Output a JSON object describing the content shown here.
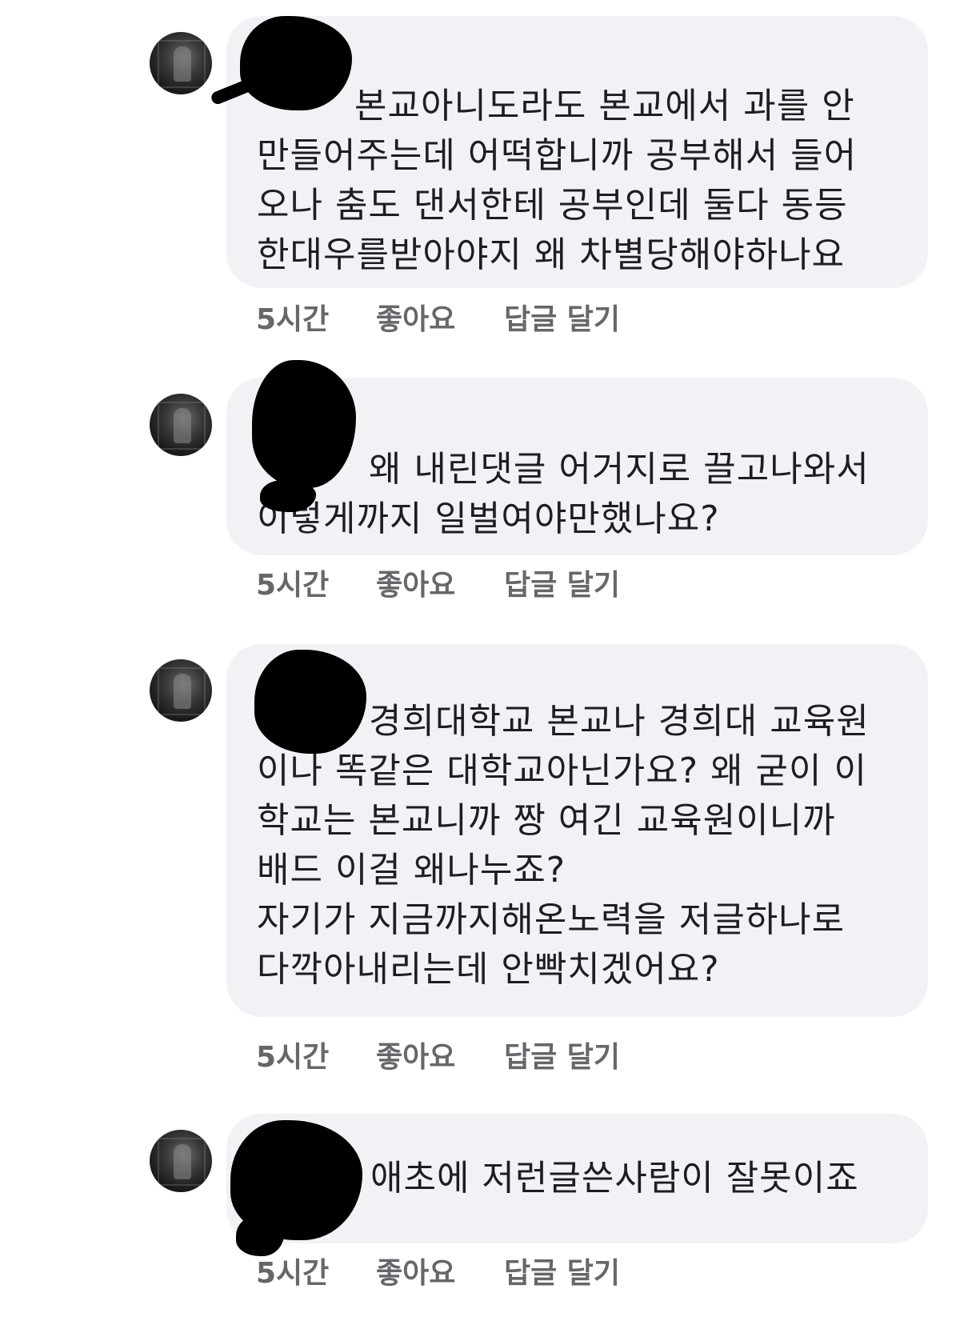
{
  "comments": [
    {
      "author": "",
      "text": "본교아니도라도 본교에서 과를 안\n만들어주는데 어떡합니까 공부해서 들어\n오나 춤도 댄서한테 공부인데 둘다 동등\n한대우를받아야지 왜 차별당해야하나요",
      "time": "5시간",
      "like_label": "좋아요",
      "reply_label": "답글 달기"
    },
    {
      "author": "",
      "text": "왜 내린댓글 어거지로 끌고나와서\n이렇게까지 일벌여야만했나요?",
      "time": "5시간",
      "like_label": "좋아요",
      "reply_label": "답글 달기"
    },
    {
      "author": "",
      "text": "경희대학교 본교나 경희대 교육원\n이나 똑같은 대학교아닌가요? 왜 굳이 이\n학교는 본교니까 짱 여긴 교육원이니까\n배드 이걸 왜나누죠?\n자기가 지금까지해온노력을 저글하나로\n다깍아내리는데 안빡치겠어요?",
      "time": "5시간",
      "like_label": "좋아요",
      "reply_label": "답글 달기"
    },
    {
      "author": "",
      "text": "애초에 저런글쓴사람이 잘못이죠",
      "time": "5시간",
      "like_label": "좋아요",
      "reply_label": "답글 달기"
    }
  ]
}
